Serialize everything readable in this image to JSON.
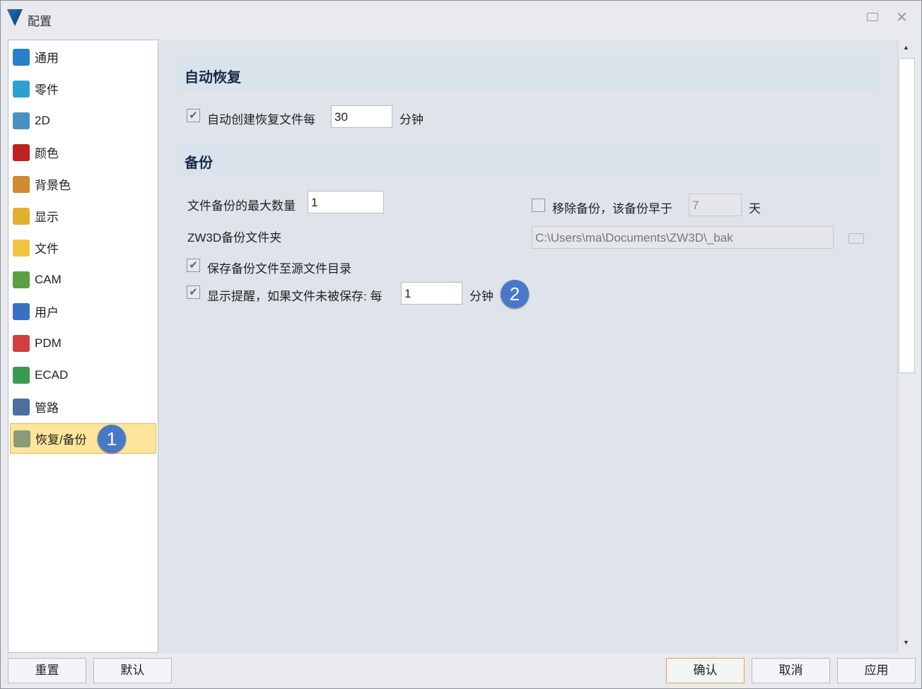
{
  "window": {
    "title": "配置"
  },
  "sidebar": {
    "items": [
      {
        "label": "通用",
        "color": "#2a7fc9"
      },
      {
        "label": "零件",
        "color": "#2ea0d0"
      },
      {
        "label": "2D",
        "color": "#4a90c0"
      },
      {
        "label": "颜色",
        "color": "#c02020"
      },
      {
        "label": "背景色",
        "color": "#d08a30"
      },
      {
        "label": "显示",
        "color": "#e0b030"
      },
      {
        "label": "文件",
        "color": "#f2c540"
      },
      {
        "label": "CAM",
        "color": "#5aa040"
      },
      {
        "label": "用户",
        "color": "#3a70c0"
      },
      {
        "label": "PDM",
        "color": "#d04040"
      },
      {
        "label": "ECAD",
        "color": "#3a9a50"
      },
      {
        "label": "管路",
        "color": "#4a70a0"
      },
      {
        "label": "恢复/备份",
        "color": "#8a9a7a"
      }
    ],
    "selected": "恢复/备份"
  },
  "main": {
    "recovery": {
      "title": "自动恢复",
      "auto_create_label": "自动创建恢复文件每",
      "auto_create_checked": true,
      "interval": "30",
      "unit": "分钟"
    },
    "backup": {
      "title": "备份",
      "max_count_label": "文件备份的最大数量",
      "max_count": "1",
      "folder_label": "ZW3D备份文件夹",
      "folder_path": "C:\\Users\\ma\\Documents\\ZW3D\\_bak",
      "remove_label": "移除备份，该备份早于",
      "remove_checked": false,
      "remove_days": "7",
      "days_unit": "天",
      "save_to_source_label": "保存备份文件至源文件目录",
      "save_to_source_checked": true,
      "remind_label": "显示提醒，如果文件未被保存: 每",
      "remind_checked": true,
      "remind_interval": "1",
      "remind_unit": "分钟"
    }
  },
  "badges": {
    "one": "1",
    "two": "2"
  },
  "buttons": {
    "reset": "重置",
    "default": "默认",
    "ok": "确认",
    "cancel": "取消",
    "apply": "应用"
  },
  "colors": {
    "accent": "#4a78c8",
    "selected_bg": "#fde59c"
  }
}
